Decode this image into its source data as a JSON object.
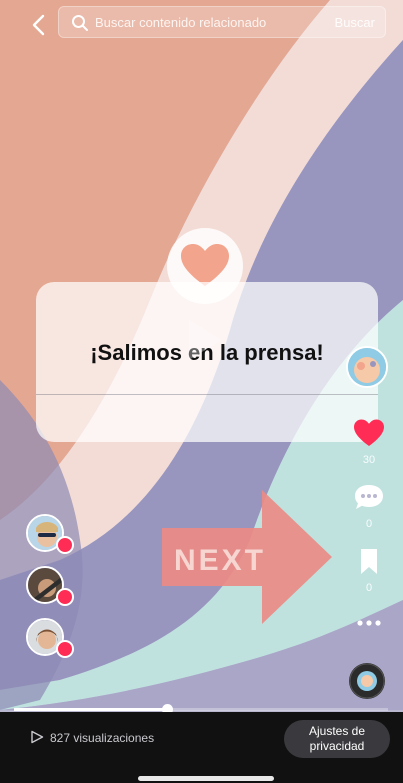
{
  "search": {
    "placeholder": "Buscar contenido relacionado",
    "button_label": "Buscar"
  },
  "post": {
    "card_title": "¡Salimos en la prensa!",
    "arrow_text": "NEXT"
  },
  "actions": {
    "likes": "30",
    "comments": "0",
    "saves": "0"
  },
  "footer": {
    "views": "827 visualizaciones",
    "privacy_line1": "Ajustes de",
    "privacy_line2": "privacidad"
  },
  "playback": {
    "progress_fraction": 0.41
  },
  "colors": {
    "like_red": "#ff2d55",
    "heart_peach": "#f2a48c",
    "arrow_coral": "#ec8b86"
  },
  "icons": [
    "back-icon",
    "search-icon",
    "heart-icon",
    "comment-icon",
    "bookmark-icon",
    "more-icon",
    "play-icon",
    "music-disc-icon"
  ]
}
